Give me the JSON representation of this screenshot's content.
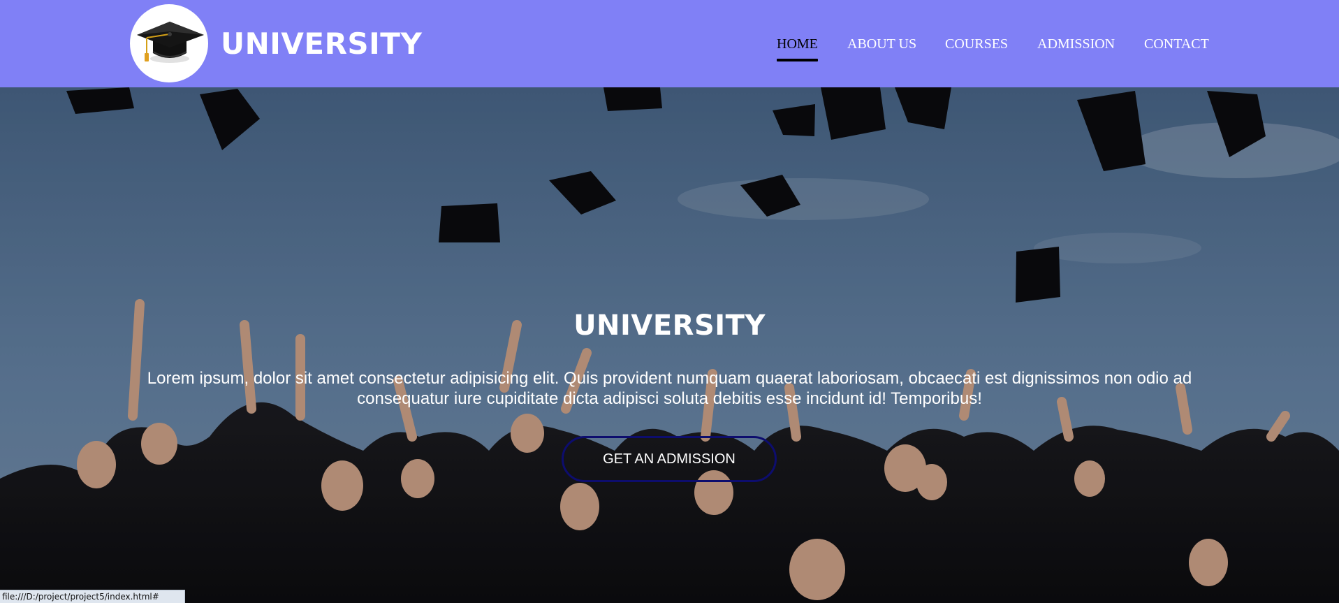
{
  "header": {
    "brand": "UNIVERSITY",
    "logo_icon": "graduation-cap-icon",
    "nav": [
      {
        "label": "HOME",
        "active": true
      },
      {
        "label": "ABOUT US",
        "active": false
      },
      {
        "label": "COURSES",
        "active": false
      },
      {
        "label": "ADMISSION",
        "active": false
      },
      {
        "label": "CONTACT",
        "active": false
      }
    ]
  },
  "hero": {
    "title": "UNIVERSITY",
    "text": "Lorem ipsum, dolor sit amet consectetur adipisicing elit. Quis provident numquam quaerat laboriosam, obcaecati est dignissimos non odio ad consequatur iure cupiditate dicta adipisci soluta debitis esse incidunt id! Temporibus!",
    "button_label": "GET AN ADMISSION",
    "background_image": "graduates-throwing-caps-photo"
  },
  "status_bar": {
    "url": "file:///D:/project/project5/index.html#"
  },
  "colors": {
    "navbar": "#8080f6",
    "button_border": "#0d0d6e",
    "text": "#ffffff",
    "active_nav": "#000000"
  }
}
